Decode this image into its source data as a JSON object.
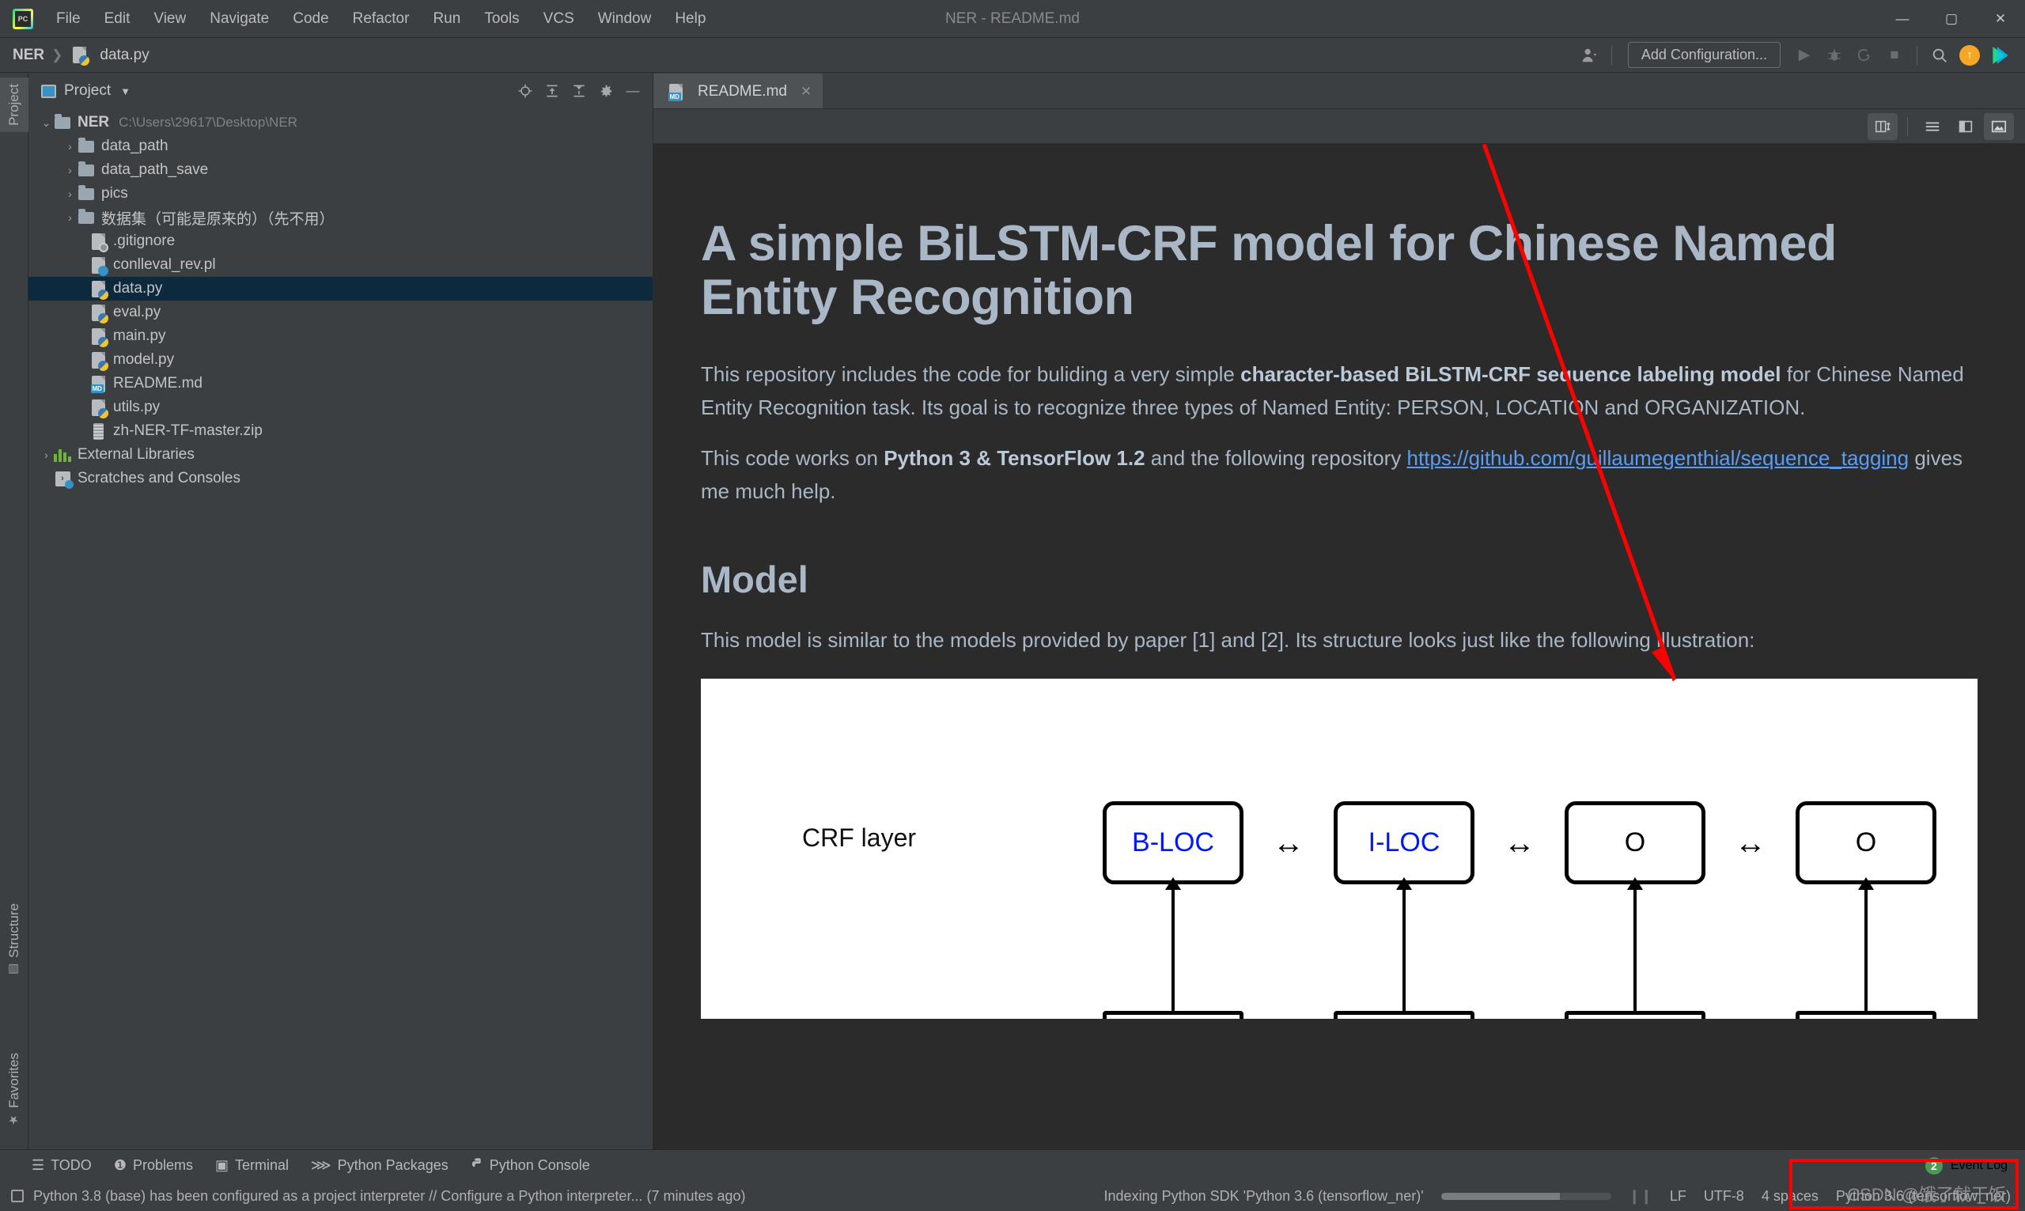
{
  "window": {
    "title": "NER - README.md",
    "app_icon": "pycharm-logo-icon",
    "minimize": "—",
    "maximize": "▢",
    "close": "✕"
  },
  "menubar": {
    "items": [
      "File",
      "Edit",
      "View",
      "Navigate",
      "Code",
      "Refactor",
      "Run",
      "Tools",
      "VCS",
      "Window",
      "Help"
    ]
  },
  "navbar": {
    "project_crumb": "NER",
    "separator": "❯",
    "file_crumb": "data.py",
    "file_icon": "python-file-icon",
    "user_icon": "user-avatar-icon",
    "caret_icon": "chevron-down-icon",
    "add_configuration": "Add Configuration...",
    "run_icon": "run-play-icon",
    "debug_icon": "debug-bug-icon",
    "coverage_icon": "run-coverage-icon",
    "stop_icon": "stop-square-icon",
    "search_icon": "search-icon",
    "update_icon": "update-arrow-icon",
    "ide_icon": "ide-feature-icon"
  },
  "left_stripe": {
    "project_label": "Project",
    "structure_label": "Structure",
    "favorites_label": "Favorites",
    "structure_icon": "structure-icon",
    "favorites_icon": "star-icon"
  },
  "project_panel": {
    "title": "Project",
    "panel_icon": "project-view-icon",
    "caret_icon": "chevron-down-icon",
    "tools": [
      {
        "name": "locate-in-tree-icon",
        "glyph": "⊕"
      },
      {
        "name": "expand-all-icon",
        "glyph": "⤓"
      },
      {
        "name": "collapse-all-icon",
        "glyph": "⤒"
      },
      {
        "name": "settings-gear-icon",
        "glyph": "✿"
      },
      {
        "name": "hide-panel-icon",
        "glyph": "—"
      }
    ],
    "tree": [
      {
        "label": "NER",
        "path": "C:\\Users\\29617\\Desktop\\NER",
        "icon": "folder-icon",
        "arrow": "⌄",
        "indent": 0,
        "bold": true,
        "selected": false
      },
      {
        "label": "data_path",
        "path": "",
        "icon": "folder-icon",
        "arrow": "›",
        "indent": 1,
        "bold": false,
        "selected": false
      },
      {
        "label": "data_path_save",
        "path": "",
        "icon": "folder-icon",
        "arrow": "›",
        "indent": 1,
        "bold": false,
        "selected": false
      },
      {
        "label": "pics",
        "path": "",
        "icon": "folder-icon",
        "arrow": "›",
        "indent": 1,
        "bold": false,
        "selected": false
      },
      {
        "label": "数据集（可能是原来的）（先不用）",
        "path": "",
        "icon": "folder-icon",
        "arrow": "›",
        "indent": 1,
        "bold": false,
        "selected": false
      },
      {
        "label": ".gitignore",
        "path": "",
        "icon": "gitignore-file-icon",
        "arrow": "",
        "indent": 2,
        "bold": false,
        "selected": false
      },
      {
        "label": "conlleval_rev.pl",
        "path": "",
        "icon": "perl-file-icon",
        "arrow": "",
        "indent": 2,
        "bold": false,
        "selected": false
      },
      {
        "label": "data.py",
        "path": "",
        "icon": "python-file-icon",
        "arrow": "",
        "indent": 2,
        "bold": false,
        "selected": true
      },
      {
        "label": "eval.py",
        "path": "",
        "icon": "python-file-icon",
        "arrow": "",
        "indent": 2,
        "bold": false,
        "selected": false
      },
      {
        "label": "main.py",
        "path": "",
        "icon": "python-file-icon",
        "arrow": "",
        "indent": 2,
        "bold": false,
        "selected": false
      },
      {
        "label": "model.py",
        "path": "",
        "icon": "python-file-icon",
        "arrow": "",
        "indent": 2,
        "bold": false,
        "selected": false
      },
      {
        "label": "README.md",
        "path": "",
        "icon": "markdown-file-icon",
        "arrow": "",
        "indent": 2,
        "bold": false,
        "selected": false
      },
      {
        "label": "utils.py",
        "path": "",
        "icon": "python-file-icon",
        "arrow": "",
        "indent": 2,
        "bold": false,
        "selected": false
      },
      {
        "label": "zh-NER-TF-master.zip",
        "path": "",
        "icon": "zip-file-icon",
        "arrow": "",
        "indent": 2,
        "bold": false,
        "selected": false
      },
      {
        "label": "External Libraries",
        "path": "",
        "icon": "libraries-icon",
        "arrow": "›",
        "indent": 0,
        "bold": false,
        "selected": false
      },
      {
        "label": "Scratches and Consoles",
        "path": "",
        "icon": "scratches-icon",
        "arrow": "",
        "indent": 1,
        "bold": false,
        "selected": false
      }
    ]
  },
  "editor": {
    "tab": {
      "label": "README.md",
      "icon": "markdown-file-icon",
      "close_icon": "close-icon"
    },
    "toolbar": [
      {
        "name": "split-editor-preview-icon",
        "glyph": "◫",
        "active": true
      },
      {
        "name": "show-editor-only-icon",
        "glyph": "☰",
        "active": false
      },
      {
        "name": "show-editor-and-preview-icon",
        "glyph": "◨",
        "active": false
      },
      {
        "name": "show-preview-only-icon",
        "glyph": "🖼",
        "active": true
      }
    ]
  },
  "readme": {
    "h1": "A simple BiLSTM-CRF model for Chinese Named Entity Recognition",
    "p1_part1": "This repository includes the code for buliding a very simple ",
    "p1_strong": "character-based BiLSTM-CRF sequence labeling model",
    "p1_part2": " for Chinese Named Entity Recognition task. Its goal is to recognize three types of Named Entity: PERSON, LOCATION and ORGANIZATION.",
    "p2_part1": "This code works on ",
    "p2_strong": "Python 3 & TensorFlow 1.2",
    "p2_part2": " and the following repository ",
    "p2_link": "https://github.com/guillaumegenthial/sequence_tagging",
    "p2_part3": " gives me much help.",
    "h2": "Model",
    "p3": "This model is similar to the models provided by paper [1] and [2]. Its structure looks just like the following illustration:",
    "figure": {
      "layer_label": "CRF layer",
      "nodes": [
        "B-LOC",
        "I-LOC",
        "O",
        "O"
      ],
      "arrow_glyph": "↔"
    }
  },
  "toolwindow_bar": {
    "items": [
      {
        "label": "TODO",
        "icon": "todo-list-icon",
        "glyph": "☰"
      },
      {
        "label": "Problems",
        "icon": "problems-icon",
        "glyph": "❶"
      },
      {
        "label": "Terminal",
        "icon": "terminal-icon",
        "glyph": "▣"
      },
      {
        "label": "Python Packages",
        "icon": "python-packages-icon",
        "glyph": "⋙"
      },
      {
        "label": "Python Console",
        "icon": "python-console-icon",
        "glyph": "🐍"
      }
    ],
    "event_log": {
      "label": "Event Log",
      "count": "2",
      "icon": "event-log-icon"
    }
  },
  "statusbar": {
    "message_icon": "notification-icon",
    "message": "Python 3.8 (base) has been configured as a project interpreter // Configure a Python interpreter... (7 minutes ago)",
    "indexing": "Indexing Python SDK 'Python 3.6 (tensorflow_ner)'",
    "pause_icon": "pause-icon",
    "line_separator": "LF",
    "encoding": "UTF-8",
    "indent": "4 spaces",
    "interpreter": "Python 3.6 (tensorflow_ner)",
    "watermark": "CSDN @饿了就干饭"
  },
  "colors": {
    "accent_blue": "#3592c4",
    "link_blue": "#589df6",
    "text": "#a9b7c6",
    "selection": "#0d293e",
    "panel": "#3c3f41",
    "editor_bg": "#2b2b2b",
    "annotation_red": "#ff0000",
    "badge_green": "#499c54"
  }
}
